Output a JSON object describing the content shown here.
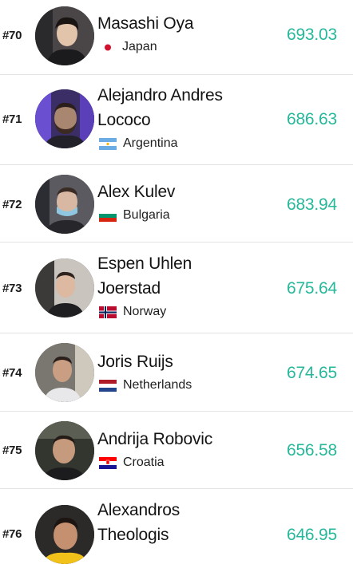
{
  "players": [
    {
      "rank": "#70",
      "name_lines": [
        "Masashi Oya"
      ],
      "country": "Japan",
      "flag": "japan",
      "score": "693.03"
    },
    {
      "rank": "#71",
      "name_lines": [
        "Alejandro Andres",
        "Lococo"
      ],
      "country": "Argentina",
      "flag": "argentina",
      "score": "686.63"
    },
    {
      "rank": "#72",
      "name_lines": [
        "Alex Kulev"
      ],
      "country": "Bulgaria",
      "flag": "bulgaria",
      "score": "683.94"
    },
    {
      "rank": "#73",
      "name_lines": [
        "Espen Uhlen",
        "Joerstad"
      ],
      "country": "Norway",
      "flag": "norway",
      "score": "675.64"
    },
    {
      "rank": "#74",
      "name_lines": [
        "Joris Ruijs"
      ],
      "country": "Netherlands",
      "flag": "netherlands",
      "score": "674.65"
    },
    {
      "rank": "#75",
      "name_lines": [
        "Andrija Robovic"
      ],
      "country": "Croatia",
      "flag": "croatia",
      "score": "656.58"
    },
    {
      "rank": "#76",
      "name_lines": [
        "Alexandros",
        "Theologis"
      ],
      "country": "",
      "flag": "",
      "score": "646.95"
    }
  ],
  "colors": {
    "score": "#26b89a",
    "rank": "#1b1b1b",
    "divider": "#e4e4e4"
  }
}
